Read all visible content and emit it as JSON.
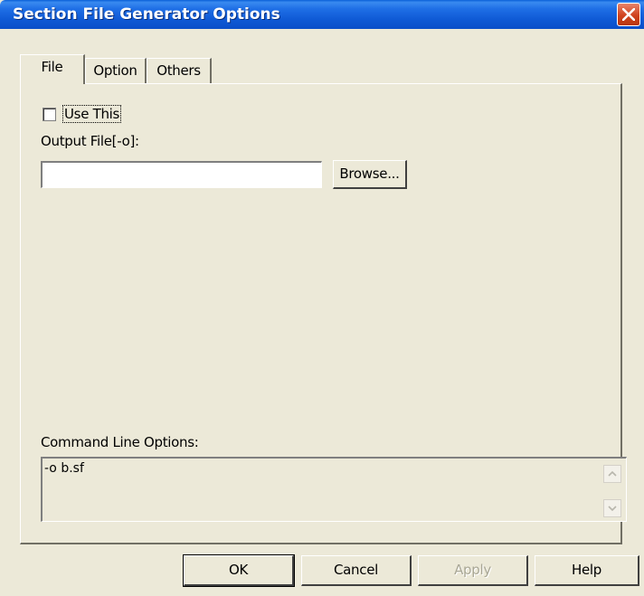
{
  "window": {
    "title": "Section File Generator Options"
  },
  "tabs": [
    {
      "label": "File",
      "active": true
    },
    {
      "label": "Option",
      "active": false
    },
    {
      "label": "Others",
      "active": false
    }
  ],
  "file_tab": {
    "use_this": {
      "label": "Use This",
      "checked": false
    },
    "output_file": {
      "label": "Output File[-o]:",
      "value": ""
    },
    "browse_label": "Browse...",
    "command_line": {
      "label": "Command Line Options:",
      "value": "-o b.sf"
    }
  },
  "buttons": {
    "ok": "OK",
    "cancel": "Cancel",
    "apply": "Apply",
    "help": "Help"
  },
  "icons": {
    "close": "close-icon",
    "scroll_up": "scroll-up-arrow-icon",
    "scroll_down": "scroll-down-arrow-icon"
  }
}
